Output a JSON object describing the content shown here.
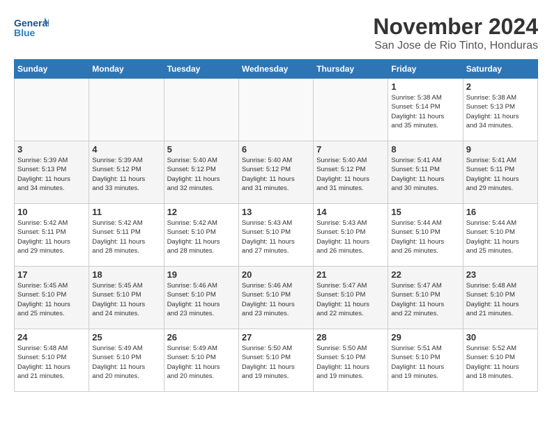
{
  "logo": {
    "line1": "General",
    "line2": "Blue"
  },
  "title": "November 2024",
  "location": "San Jose de Rio Tinto, Honduras",
  "weekdays": [
    "Sunday",
    "Monday",
    "Tuesday",
    "Wednesday",
    "Thursday",
    "Friday",
    "Saturday"
  ],
  "weeks": [
    [
      {
        "day": "",
        "info": ""
      },
      {
        "day": "",
        "info": ""
      },
      {
        "day": "",
        "info": ""
      },
      {
        "day": "",
        "info": ""
      },
      {
        "day": "",
        "info": ""
      },
      {
        "day": "1",
        "info": "Sunrise: 5:38 AM\nSunset: 5:14 PM\nDaylight: 11 hours\nand 35 minutes."
      },
      {
        "day": "2",
        "info": "Sunrise: 5:38 AM\nSunset: 5:13 PM\nDaylight: 11 hours\nand 34 minutes."
      }
    ],
    [
      {
        "day": "3",
        "info": "Sunrise: 5:39 AM\nSunset: 5:13 PM\nDaylight: 11 hours\nand 34 minutes."
      },
      {
        "day": "4",
        "info": "Sunrise: 5:39 AM\nSunset: 5:12 PM\nDaylight: 11 hours\nand 33 minutes."
      },
      {
        "day": "5",
        "info": "Sunrise: 5:40 AM\nSunset: 5:12 PM\nDaylight: 11 hours\nand 32 minutes."
      },
      {
        "day": "6",
        "info": "Sunrise: 5:40 AM\nSunset: 5:12 PM\nDaylight: 11 hours\nand 31 minutes."
      },
      {
        "day": "7",
        "info": "Sunrise: 5:40 AM\nSunset: 5:12 PM\nDaylight: 11 hours\nand 31 minutes."
      },
      {
        "day": "8",
        "info": "Sunrise: 5:41 AM\nSunset: 5:11 PM\nDaylight: 11 hours\nand 30 minutes."
      },
      {
        "day": "9",
        "info": "Sunrise: 5:41 AM\nSunset: 5:11 PM\nDaylight: 11 hours\nand 29 minutes."
      }
    ],
    [
      {
        "day": "10",
        "info": "Sunrise: 5:42 AM\nSunset: 5:11 PM\nDaylight: 11 hours\nand 29 minutes."
      },
      {
        "day": "11",
        "info": "Sunrise: 5:42 AM\nSunset: 5:11 PM\nDaylight: 11 hours\nand 28 minutes."
      },
      {
        "day": "12",
        "info": "Sunrise: 5:42 AM\nSunset: 5:10 PM\nDaylight: 11 hours\nand 28 minutes."
      },
      {
        "day": "13",
        "info": "Sunrise: 5:43 AM\nSunset: 5:10 PM\nDaylight: 11 hours\nand 27 minutes."
      },
      {
        "day": "14",
        "info": "Sunrise: 5:43 AM\nSunset: 5:10 PM\nDaylight: 11 hours\nand 26 minutes."
      },
      {
        "day": "15",
        "info": "Sunrise: 5:44 AM\nSunset: 5:10 PM\nDaylight: 11 hours\nand 26 minutes."
      },
      {
        "day": "16",
        "info": "Sunrise: 5:44 AM\nSunset: 5:10 PM\nDaylight: 11 hours\nand 25 minutes."
      }
    ],
    [
      {
        "day": "17",
        "info": "Sunrise: 5:45 AM\nSunset: 5:10 PM\nDaylight: 11 hours\nand 25 minutes."
      },
      {
        "day": "18",
        "info": "Sunrise: 5:45 AM\nSunset: 5:10 PM\nDaylight: 11 hours\nand 24 minutes."
      },
      {
        "day": "19",
        "info": "Sunrise: 5:46 AM\nSunset: 5:10 PM\nDaylight: 11 hours\nand 23 minutes."
      },
      {
        "day": "20",
        "info": "Sunrise: 5:46 AM\nSunset: 5:10 PM\nDaylight: 11 hours\nand 23 minutes."
      },
      {
        "day": "21",
        "info": "Sunrise: 5:47 AM\nSunset: 5:10 PM\nDaylight: 11 hours\nand 22 minutes."
      },
      {
        "day": "22",
        "info": "Sunrise: 5:47 AM\nSunset: 5:10 PM\nDaylight: 11 hours\nand 22 minutes."
      },
      {
        "day": "23",
        "info": "Sunrise: 5:48 AM\nSunset: 5:10 PM\nDaylight: 11 hours\nand 21 minutes."
      }
    ],
    [
      {
        "day": "24",
        "info": "Sunrise: 5:48 AM\nSunset: 5:10 PM\nDaylight: 11 hours\nand 21 minutes."
      },
      {
        "day": "25",
        "info": "Sunrise: 5:49 AM\nSunset: 5:10 PM\nDaylight: 11 hours\nand 20 minutes."
      },
      {
        "day": "26",
        "info": "Sunrise: 5:49 AM\nSunset: 5:10 PM\nDaylight: 11 hours\nand 20 minutes."
      },
      {
        "day": "27",
        "info": "Sunrise: 5:50 AM\nSunset: 5:10 PM\nDaylight: 11 hours\nand 19 minutes."
      },
      {
        "day": "28",
        "info": "Sunrise: 5:50 AM\nSunset: 5:10 PM\nDaylight: 11 hours\nand 19 minutes."
      },
      {
        "day": "29",
        "info": "Sunrise: 5:51 AM\nSunset: 5:10 PM\nDaylight: 11 hours\nand 19 minutes."
      },
      {
        "day": "30",
        "info": "Sunrise: 5:52 AM\nSunset: 5:10 PM\nDaylight: 11 hours\nand 18 minutes."
      }
    ]
  ]
}
